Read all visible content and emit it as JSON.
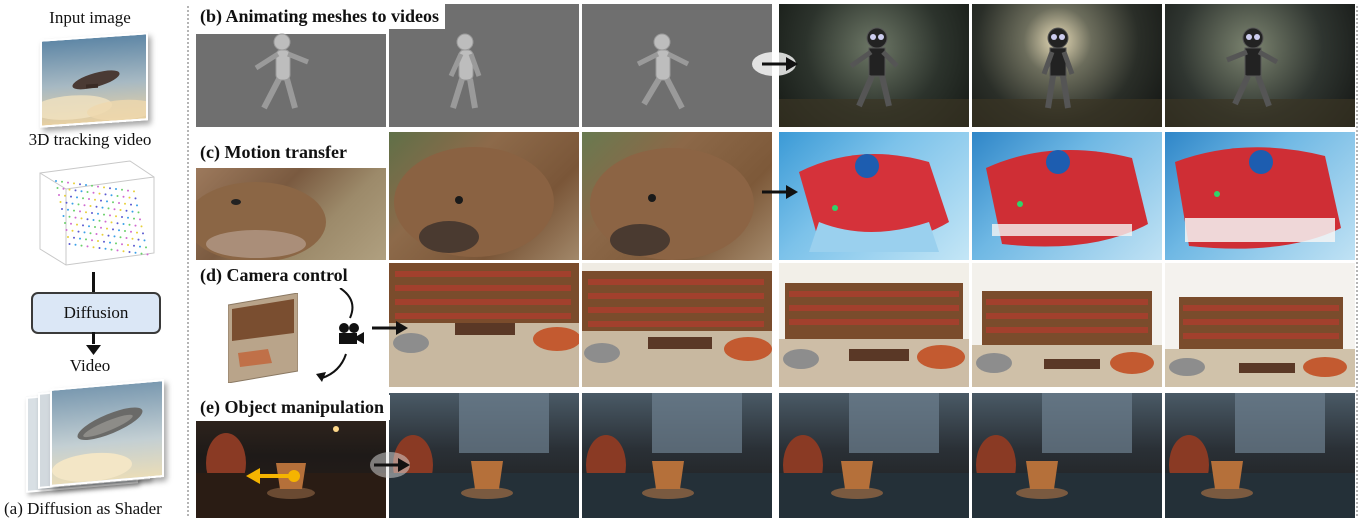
{
  "pipeline": {
    "input_label": "Input image",
    "tracking_label": "3D tracking video",
    "diffusion_label": "Diffusion",
    "video_label": "Video",
    "caption": "(a) Diffusion as Shader"
  },
  "rows": [
    {
      "title": "(b) Animating meshes to videos"
    },
    {
      "title": "(c) Motion transfer"
    },
    {
      "title": "(d) Camera control"
    },
    {
      "title": "(e) Object manipulation"
    }
  ],
  "icons": [
    "arrow-right-icon",
    "camera-icon",
    "curved-arrow-icon",
    "arrow-down-icon"
  ],
  "colors": {
    "diffusion_box": "#dbe7f6",
    "divider": "#b5b5b5",
    "manipulation_arrow": "#f5b400"
  }
}
